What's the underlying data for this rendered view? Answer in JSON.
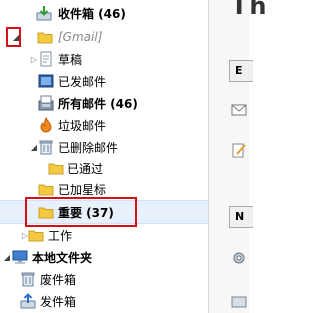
{
  "folders": {
    "inbox": "收件箱 (46)",
    "gmail_account": "[Gmail]",
    "drafts": "草稿",
    "sent": "已发邮件",
    "all_mail": "所有邮件 (46)",
    "spam": "垃圾邮件",
    "deleted": "已删除邮件",
    "passed": "已通过",
    "starred": "已加星标",
    "important": "重要 (37)",
    "work": "工作",
    "local_folders": "本地文件夹",
    "trash": "废件箱",
    "outbox": "发件箱"
  },
  "right_pane": {
    "title_fragment": "Th"
  },
  "colors": {
    "highlight_border": "#d4101a",
    "selected_row": "#e8f1fb",
    "folder_yellow": "#f5c842"
  }
}
